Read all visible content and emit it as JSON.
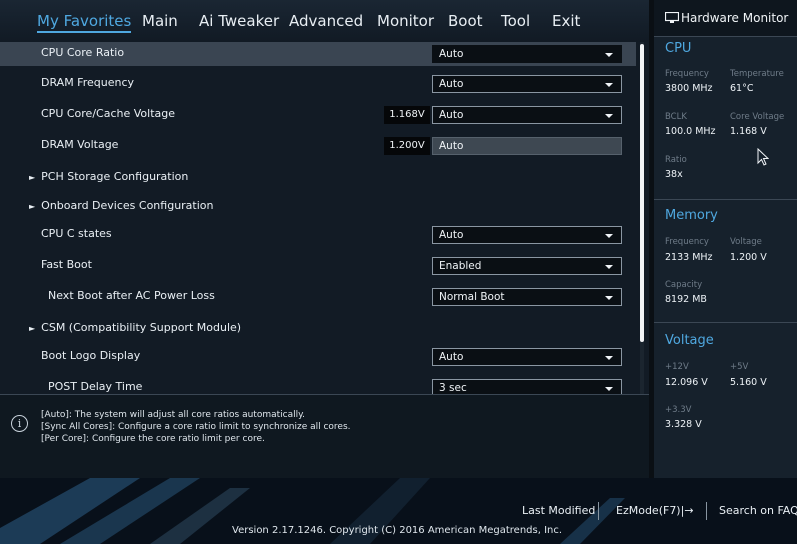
{
  "menu": {
    "tabs": [
      "My Favorites",
      "Main",
      "Ai Tweaker",
      "Advanced",
      "Monitor",
      "Boot",
      "Tool",
      "Exit"
    ],
    "active_tab": "My Favorites"
  },
  "settings": {
    "cpu_core_ratio": {
      "label": "CPU Core Ratio",
      "value": "Auto"
    },
    "dram_frequency": {
      "label": "DRAM Frequency",
      "value": "Auto"
    },
    "cpu_core_cache_voltage": {
      "label": "CPU Core/Cache Voltage",
      "readout": "1.168V",
      "value": "Auto"
    },
    "dram_voltage": {
      "label": "DRAM Voltage",
      "readout": "1.200V",
      "value": "Auto"
    },
    "pch_storage": {
      "label": "PCH Storage Configuration"
    },
    "onboard_devices": {
      "label": "Onboard Devices Configuration"
    },
    "cpu_c_states": {
      "label": "CPU C states",
      "value": "Auto"
    },
    "fast_boot": {
      "label": "Fast Boot",
      "value": "Enabled"
    },
    "next_boot_after_ac_loss": {
      "label": "Next Boot after AC Power Loss",
      "value": "Normal Boot"
    },
    "csm": {
      "label": "CSM (Compatibility Support Module)"
    },
    "boot_logo_display": {
      "label": "Boot Logo Display",
      "value": "Auto"
    },
    "post_delay_time": {
      "label": "POST Delay Time",
      "value": "3 sec"
    }
  },
  "help": {
    "line1": "[Auto]: The system will adjust all core ratios automatically.",
    "line2": "[Sync All Cores]: Configure a core ratio limit to synchronize all cores.",
    "line3": "[Per Core]: Configure the core ratio limit per core."
  },
  "hardware_monitor": {
    "title": "Hardware Monitor",
    "cpu": {
      "heading": "CPU",
      "frequency_label": "Frequency",
      "frequency": "3800 MHz",
      "temperature_label": "Temperature",
      "temperature": "61°C",
      "bclk_label": "BCLK",
      "bclk": "100.0 MHz",
      "core_voltage_label": "Core Voltage",
      "core_voltage": "1.168 V",
      "ratio_label": "Ratio",
      "ratio": "38x"
    },
    "memory": {
      "heading": "Memory",
      "frequency_label": "Frequency",
      "frequency": "2133 MHz",
      "voltage_label": "Voltage",
      "voltage": "1.200 V",
      "capacity_label": "Capacity",
      "capacity": "8192 MB"
    },
    "voltage": {
      "heading": "Voltage",
      "v12_label": "+12V",
      "v12": "12.096 V",
      "v5_label": "+5V",
      "v5": "5.160 V",
      "v33_label": "+3.3V",
      "v33": "3.328 V"
    }
  },
  "footer": {
    "last_modified": "Last Modified",
    "ezmode": "EzMode(F7)|",
    "search": "Search on FAQ",
    "version": "Version 2.17.1246. Copyright (C) 2016 American Megatrends, Inc."
  },
  "colors": {
    "accent": "#4fa8e0",
    "panel_bg": "#121b25",
    "selected_row": "#3a4552"
  }
}
